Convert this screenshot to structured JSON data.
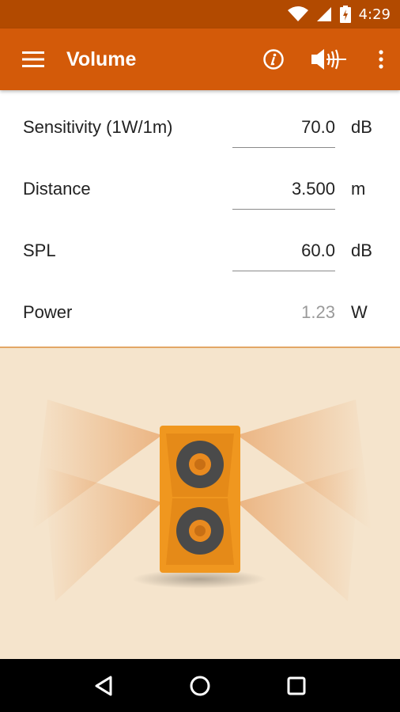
{
  "status_bar": {
    "time": "4:29",
    "icons": [
      "wifi-icon",
      "signal-icon",
      "battery-charging-icon"
    ]
  },
  "app_bar": {
    "title": "Volume",
    "icons": [
      "menu-icon",
      "info-icon",
      "speaker-wave-icon",
      "more-vert-icon"
    ]
  },
  "fields": [
    {
      "label": "Sensitivity (1W/1m)",
      "value": "70.0",
      "unit": "dB",
      "editable": true
    },
    {
      "label": "Distance",
      "value": "3.500",
      "unit": "m",
      "editable": true
    },
    {
      "label": "SPL",
      "value": "60.0",
      "unit": "dB",
      "editable": true
    },
    {
      "label": "Power",
      "value": "1.23",
      "unit": "W",
      "editable": false
    }
  ],
  "colors": {
    "status_bar": "#b24a00",
    "app_bar": "#d35a09",
    "scene_background": "#f5e4cc",
    "speaker_body": "#f0971f",
    "woofer": "#4a4a4a",
    "woofer_center": "#e98a1f"
  },
  "nav_bar": {
    "icons": [
      "back-icon",
      "home-icon",
      "recents-icon"
    ]
  }
}
